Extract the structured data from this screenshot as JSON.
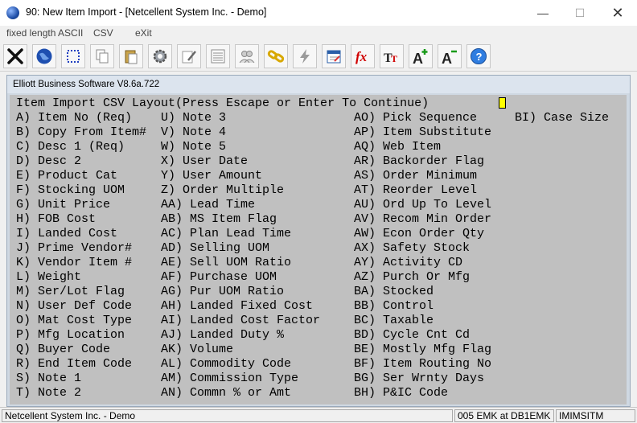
{
  "window": {
    "title": "90: New Item Import - [Netcellent System Inc. - Demo]",
    "minimize": "—",
    "maximize": "☐",
    "close": "✕"
  },
  "menu": {
    "items": [
      "fixed length ASCII",
      "CSV",
      "eXit"
    ]
  },
  "toolbar": {
    "icons": [
      "close-x-icon",
      "globe-icon",
      "select-region-icon",
      "copy-icon",
      "paste-icon",
      "settings-gear-icon",
      "edit-note-icon",
      "list-icon",
      "users-icon",
      "chain-link-icon",
      "lightning-icon",
      "calendar-icon",
      "function-fx-icon",
      "font-tt-icon",
      "font-grow-icon",
      "font-shrink-icon",
      "help-icon"
    ]
  },
  "inner_window": {
    "title": "Elliott Business Software V8.6a.722"
  },
  "screen": {
    "header": "Item Import CSV Layout(Press Escape or Enter To Continue)",
    "col1": [
      "A) Item No (Req)",
      "B) Copy From Item#",
      "C) Desc 1 (Req)",
      "D) Desc 2",
      "E) Product Cat",
      "F) Stocking UOM",
      "G) Unit Price",
      "H) FOB Cost",
      "I) Landed Cost",
      "J) Prime Vendor#",
      "K) Vendor Item #",
      "L) Weight",
      "M) Ser/Lot Flag",
      "N) User Def Code",
      "O) Mat Cost Type",
      "P) Mfg Location",
      "Q) Buyer Code",
      "R) End Item Code",
      "S) Note 1",
      "T) Note 2"
    ],
    "col2": [
      "U) Note 3",
      "V) Note 4",
      "W) Note 5",
      "X) User Date",
      "Y) User Amount",
      "Z) Order Multiple",
      "AA) Lead Time",
      "AB) MS Item Flag",
      "AC) Plan Lead Time",
      "AD) Selling UOM",
      "AE) Sell UOM Ratio",
      "AF) Purchase UOM",
      "AG) Pur UOM Ratio",
      "AH) Landed Fixed Cost",
      "AI) Landed Cost Factor",
      "AJ) Landed Duty %",
      "AK) Volume",
      "AL) Commodity Code",
      "AM) Commission Type",
      "AN) Commn % or Amt"
    ],
    "col3": [
      "AO) Pick Sequence",
      "AP) Item Substitute",
      "AQ) Web Item",
      "AR) Backorder Flag",
      "AS) Order Minimum",
      "AT) Reorder Level",
      "AU) Ord Up To Level",
      "AV) Recom Min Order",
      "AW) Econ Order Qty",
      "AX) Safety Stock",
      "AY) Activity CD",
      "AZ) Purch Or Mfg",
      "BA) Stocked",
      "BB) Control",
      "BC) Taxable",
      "BD) Cycle Cnt Cd",
      "BE) Mostly Mfg Flag",
      "BF) Item Routing No",
      "BG) Ser Wrnty Days",
      "BH) P&IC Code"
    ],
    "col4": [
      "BI) Case Size"
    ]
  },
  "status": {
    "company": "Netcellent System Inc. - Demo",
    "user_db": "005 EMK at DB1EMK",
    "program": "IMIMSITM"
  }
}
